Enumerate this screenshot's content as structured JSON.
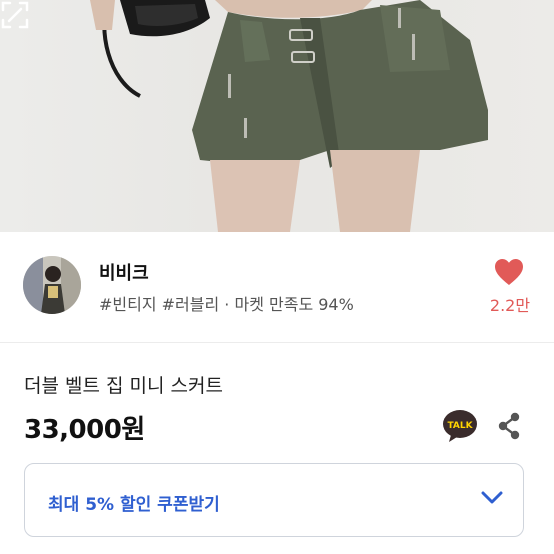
{
  "seller": {
    "name": "비비크",
    "tags": "#빈티지 #러블리 · 마켓 만족도 94%",
    "likes": "2.2만"
  },
  "product": {
    "title": "더블 벨트 집 미니 스커트",
    "price": "33,000원"
  },
  "talk_label": "TALK",
  "coupon": {
    "label": "최대 5% 할인 쿠폰받기"
  },
  "icons": [
    "expand-icon",
    "heart-icon",
    "kakaotalk-icon",
    "share-icon",
    "chevron-down-icon"
  ],
  "colors": {
    "accent_blue": "#2f5fd0",
    "heart_red": "#e15a58",
    "talk_bg": "#3a2c2c",
    "talk_yellow": "#ffd400"
  }
}
